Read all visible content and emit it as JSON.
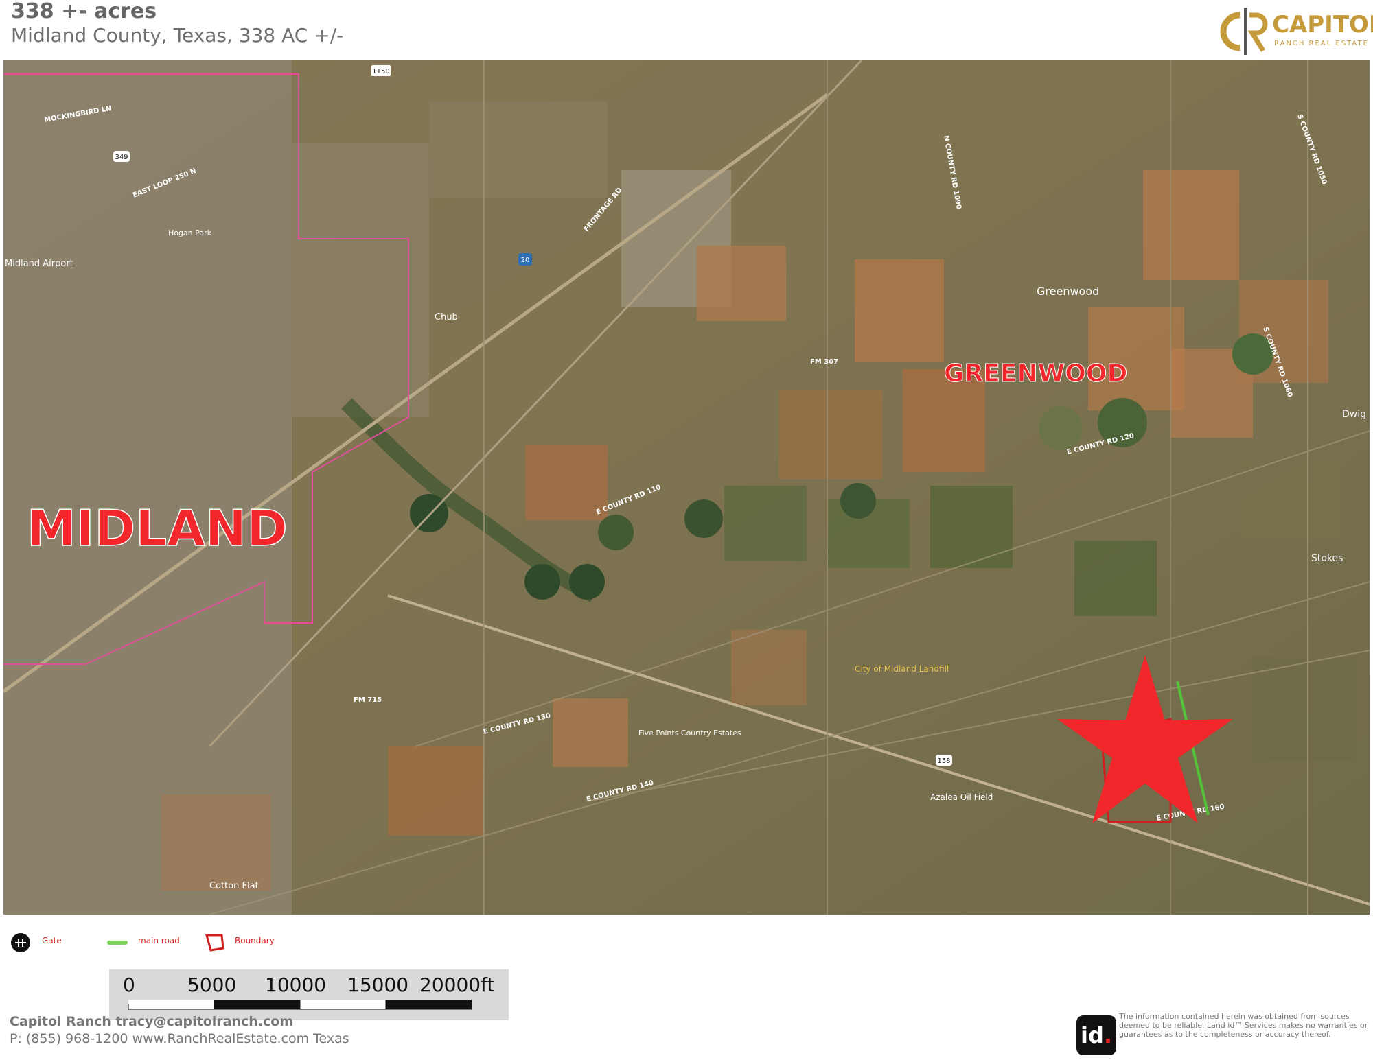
{
  "header": {
    "title": "338 +- acres",
    "subtitle": "Midland County, Texas, 338 AC +/-"
  },
  "brand": {
    "name": "CAPITOL",
    "tagline": "RANCH REAL ESTATE",
    "color": "#c49a3a"
  },
  "map": {
    "big_labels": {
      "midland": "MIDLAND",
      "greenwood": "GREENWOOD"
    },
    "place_labels": [
      {
        "text": "Midland Airport"
      },
      {
        "text": "Greenwood"
      },
      {
        "text": "Stokes"
      },
      {
        "text": "Dwig"
      },
      {
        "text": "City of Midland Landfill"
      },
      {
        "text": "Azalea Oil Field"
      },
      {
        "text": "Cotton Flat"
      },
      {
        "text": "Chub"
      },
      {
        "text": "Five Points Country Estates"
      },
      {
        "text": "Hogan Park"
      }
    ],
    "road_labels": [
      {
        "text": "FM 307"
      },
      {
        "text": "FM 715"
      },
      {
        "text": "E COUNTY RD 120"
      },
      {
        "text": "E COUNTY RD 130"
      },
      {
        "text": "E COUNTY RD 140"
      },
      {
        "text": "E COUNTY RD 160"
      },
      {
        "text": "E COUNTY RD 110"
      },
      {
        "text": "EAST LOOP 250 N"
      },
      {
        "text": "FRONTAGE RD"
      },
      {
        "text": "N COUNTY RD 1090"
      },
      {
        "text": "S COUNTY RD 1060"
      },
      {
        "text": "S COUNTY RD 1050"
      },
      {
        "text": "MOCKINGBIRD LN"
      }
    ],
    "route_shields": [
      {
        "text": "20"
      },
      {
        "text": "158"
      },
      {
        "text": "349"
      },
      {
        "text": "1150"
      }
    ],
    "marker": "red-star",
    "colors": {
      "marker": "#f2272c",
      "city_boundary": "#e0509a",
      "main_road": "#55c23a",
      "boundary": "#d11f1f"
    }
  },
  "legend": {
    "gate": "Gate",
    "main_road": "main road",
    "boundary": "Boundary"
  },
  "scalebar": {
    "ticks": [
      "0",
      "5000",
      "10000",
      "15000",
      "20000ft"
    ]
  },
  "footer": {
    "contact_line1": "Capitol Ranch tracy@capitolranch.com",
    "contact_line2": "P: (855) 968-1200 www.RanchRealEstate.com Texas",
    "id_logo": "id",
    "id_logo_dot": ".",
    "disclaimer": "The information contained herein was obtained from sources deemed to be reliable. Land id™ Services makes no warranties or guarantees as to the completeness or accuracy thereof."
  }
}
